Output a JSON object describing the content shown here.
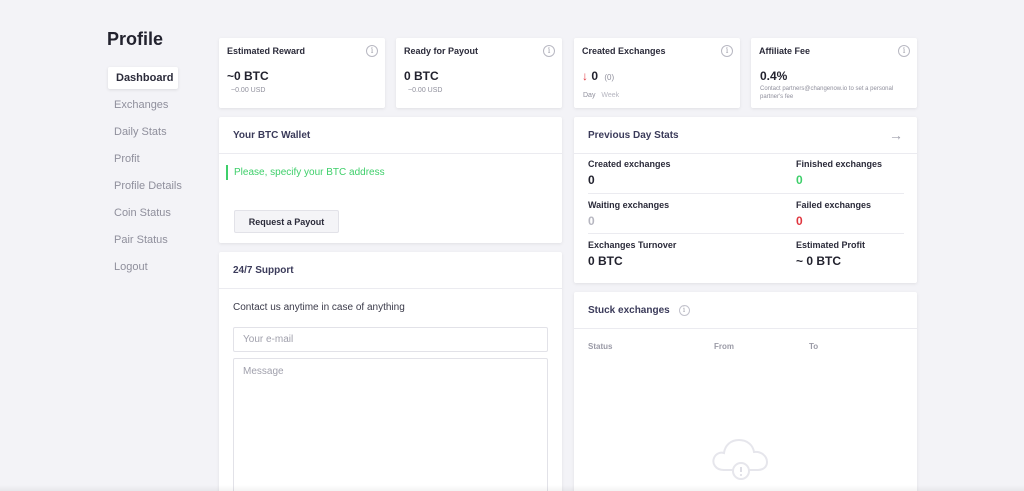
{
  "page": {
    "title": "Profile"
  },
  "sidebar": {
    "items": [
      {
        "label": "Dashboard"
      },
      {
        "label": "Exchanges"
      },
      {
        "label": "Daily Stats"
      },
      {
        "label": "Profit"
      },
      {
        "label": "Profile Details"
      },
      {
        "label": "Coin Status"
      },
      {
        "label": "Pair Status"
      },
      {
        "label": "Logout"
      }
    ]
  },
  "stats": {
    "estimated_reward": {
      "title": "Estimated Reward",
      "value": "~0 BTC",
      "sub": "~0.00 USD"
    },
    "ready_for_payout": {
      "title": "Ready for Payout",
      "value": "0 BTC",
      "sub": "~0.00 USD"
    },
    "created_exchanges": {
      "title": "Created Exchanges",
      "value": "0",
      "count": "(0)",
      "period_day": "Day",
      "period_week": "Week"
    },
    "affiliate_fee": {
      "title": "Affiliate Fee",
      "value": "0.4%",
      "note": "Contact partners@changenow.io to set a personal partner's fee"
    }
  },
  "wallet": {
    "title": "Your BTC Wallet",
    "message": "Please, specify your BTC address",
    "button": "Request a Payout"
  },
  "support": {
    "title": "24/7 Support",
    "text": "Contact us anytime in case of anything",
    "email_placeholder": "Your e-mail",
    "message_placeholder": "Message"
  },
  "previous_day": {
    "title": "Previous Day Stats",
    "created_label": "Created exchanges",
    "created_value": "0",
    "finished_label": "Finished exchanges",
    "finished_value": "0",
    "waiting_label": "Waiting exchanges",
    "waiting_value": "0",
    "failed_label": "Failed exchanges",
    "failed_value": "0",
    "turnover_label": "Exchanges Turnover",
    "turnover_value": "0 BTC",
    "profit_label": "Estimated Profit",
    "profit_value": "~ 0 BTC"
  },
  "stuck": {
    "title": "Stuck exchanges",
    "columns": [
      "Status",
      "From",
      "To"
    ]
  },
  "colors": {
    "green": "#3ecf6a",
    "red": "#e0363f",
    "grey_value": "#b6b6c0",
    "heading": "#3b3b5a"
  },
  "icons": {
    "info": "info-icon",
    "arrow_down": "arrow-down-icon",
    "arrow_right": "arrow-right-icon",
    "cloud": "cloud-info-icon"
  }
}
